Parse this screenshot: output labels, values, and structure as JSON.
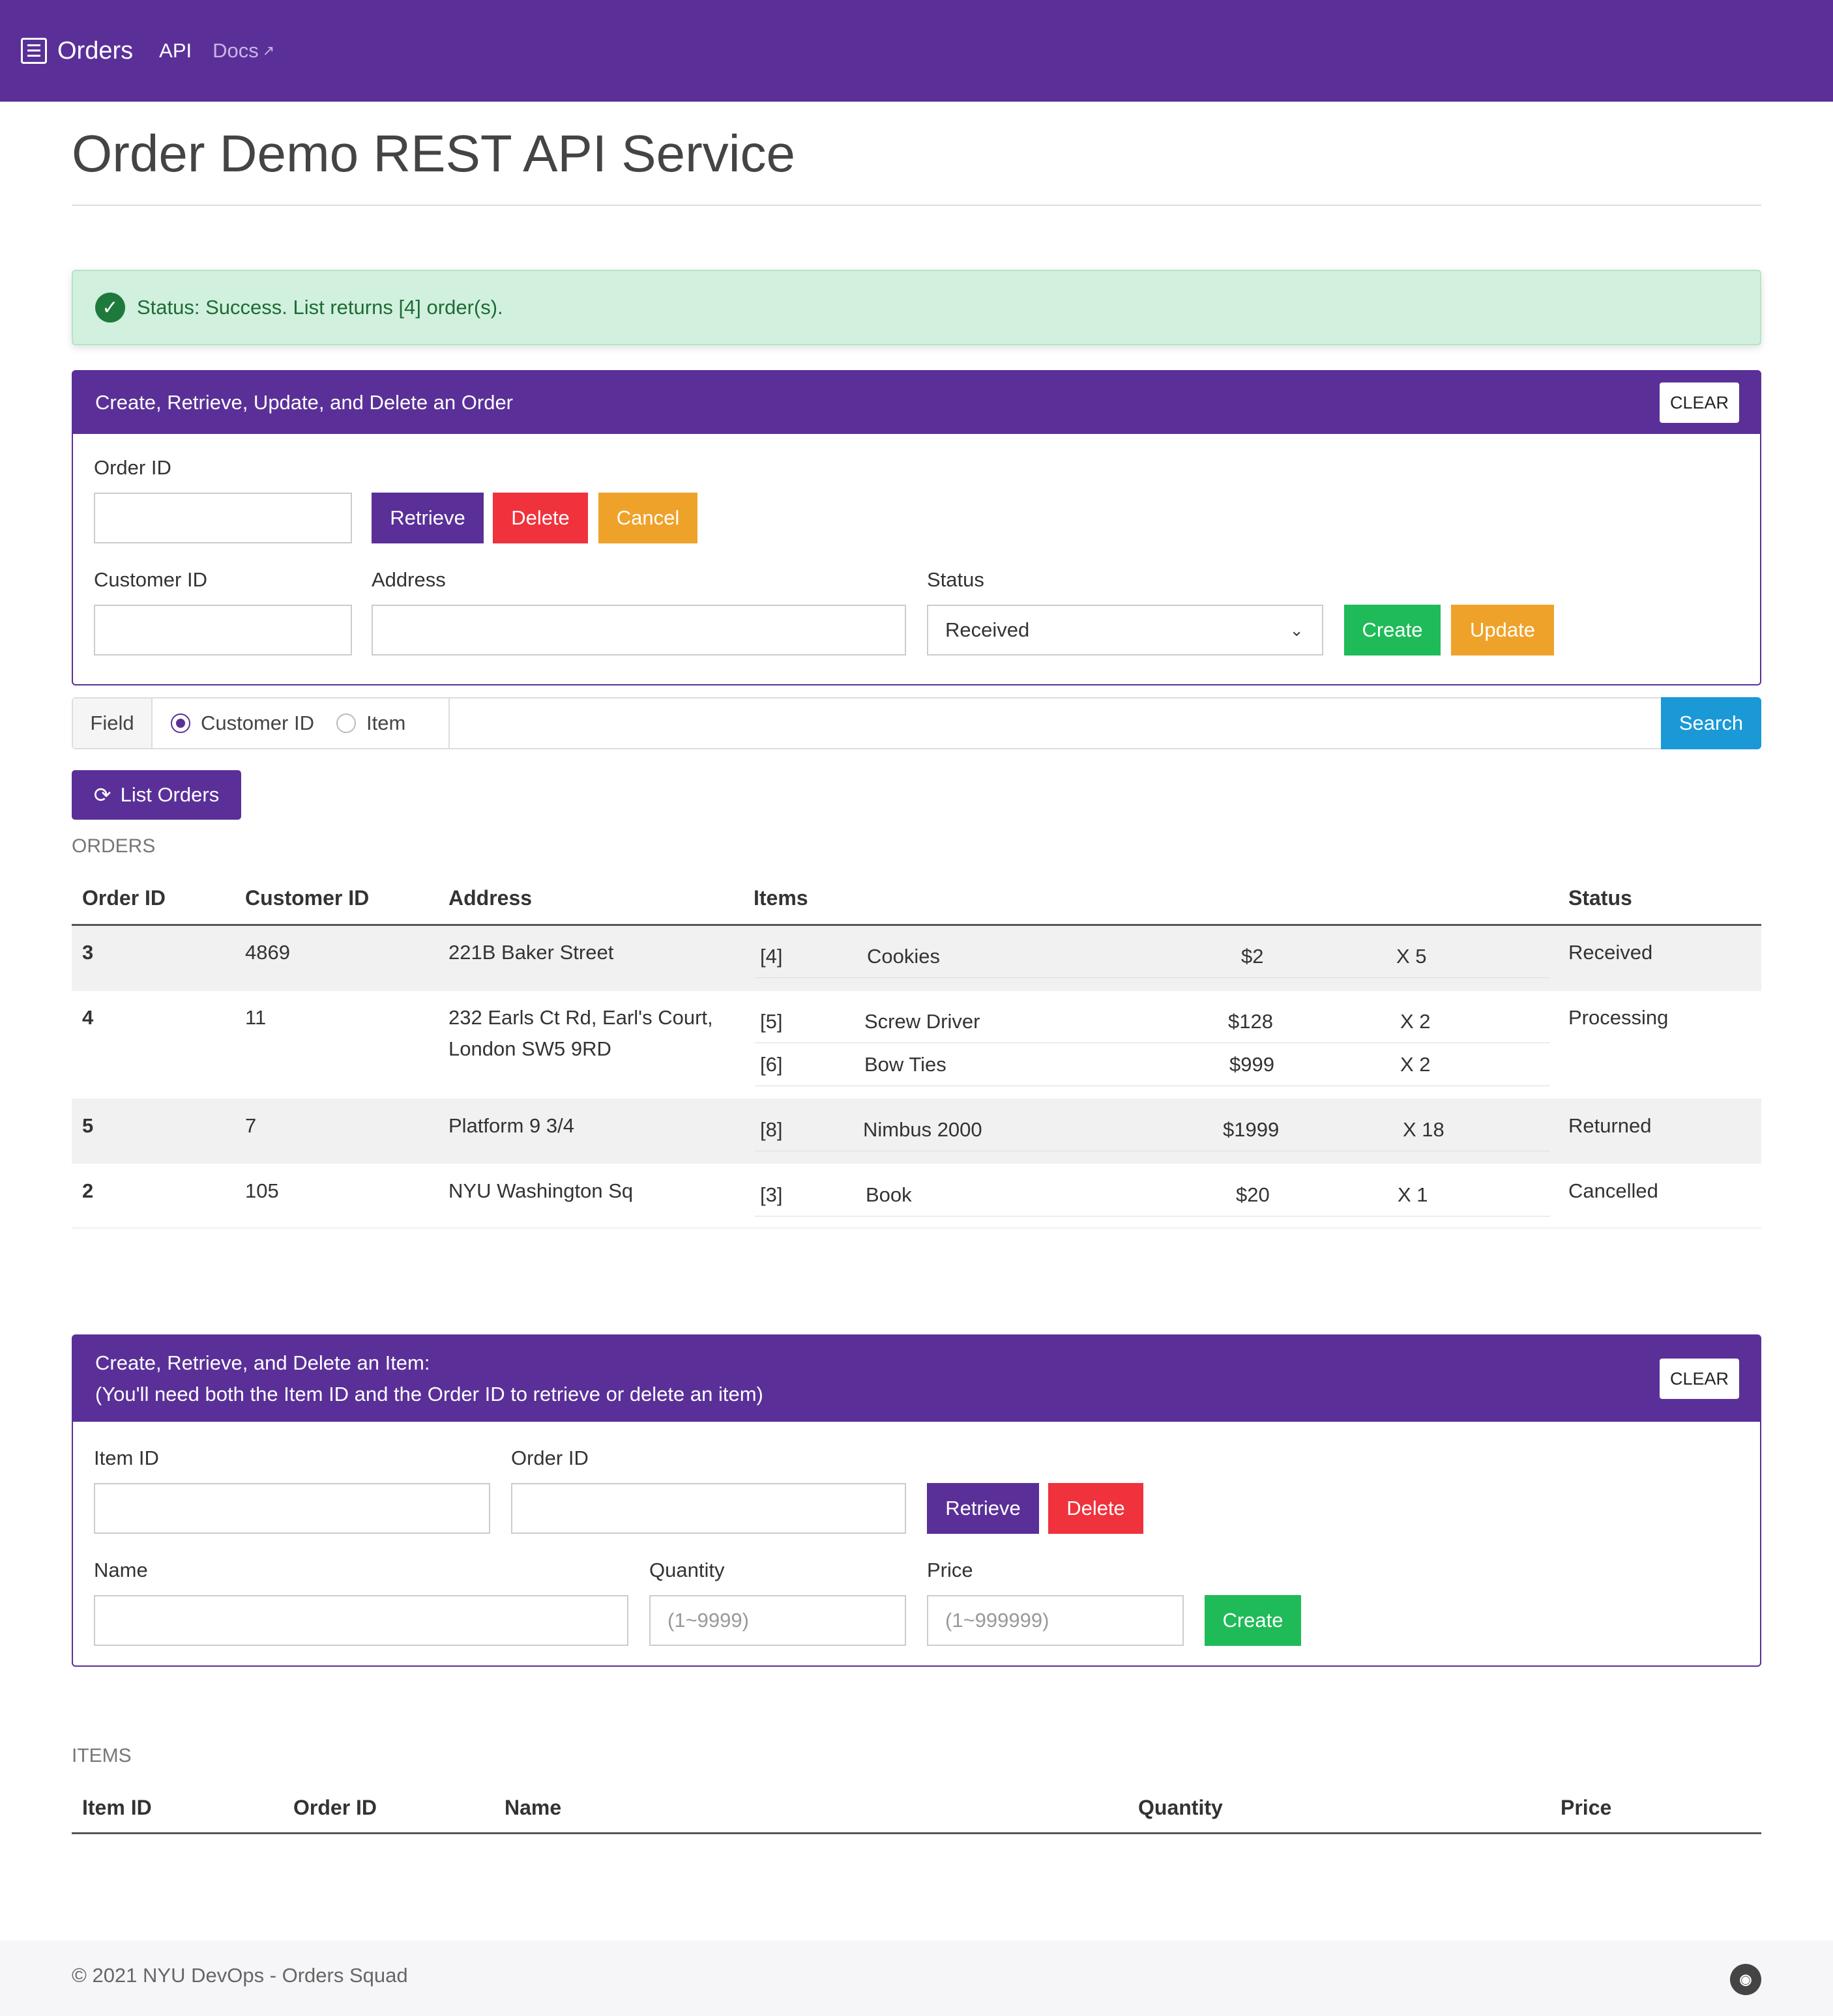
{
  "nav": {
    "brand": "Orders",
    "links": [
      {
        "label": "API"
      },
      {
        "label": "Docs"
      }
    ]
  },
  "page_title": "Order Demo REST API Service",
  "alert": {
    "text": "Status: Success. List returns [4] order(s)."
  },
  "order_form": {
    "title": "Create, Retrieve, Update, and Delete an Order",
    "clear": "CLEAR",
    "order_id_label": "Order ID",
    "order_id_value": "",
    "retrieve": "Retrieve",
    "delete": "Delete",
    "cancel": "Cancel",
    "customer_id_label": "Customer ID",
    "customer_id_value": "",
    "address_label": "Address",
    "address_value": "",
    "status_label": "Status",
    "status_value": "Received",
    "create": "Create",
    "update": "Update"
  },
  "search": {
    "field_label": "Field",
    "options": [
      "Customer ID",
      "Item"
    ],
    "selected": "Customer ID",
    "value": "",
    "button": "Search"
  },
  "list_orders": "List Orders",
  "orders": {
    "section_title": "ORDERS",
    "headers": [
      "Order ID",
      "Customer ID",
      "Address",
      "Items",
      "Status"
    ],
    "rows": [
      {
        "order_id": "3",
        "customer_id": "4869",
        "address": "221B Baker Street",
        "address2": "",
        "status": "Received",
        "items": [
          {
            "id": "[4]",
            "name": "Cookies",
            "price": "$2",
            "qty": "X 5"
          }
        ]
      },
      {
        "order_id": "4",
        "customer_id": "11",
        "address": "232 Earls Ct Rd, Earl's Court,",
        "address2": "London SW5 9RD",
        "status": "Processing",
        "items": [
          {
            "id": "[5]",
            "name": "Screw Driver",
            "price": "$128",
            "qty": "X 2"
          },
          {
            "id": "[6]",
            "name": "Bow Ties",
            "price": "$999",
            "qty": "X 2"
          }
        ]
      },
      {
        "order_id": "5",
        "customer_id": "7",
        "address": "Platform 9 3/4",
        "address2": "",
        "status": "Returned",
        "items": [
          {
            "id": "[8]",
            "name": "Nimbus 2000",
            "price": "$1999",
            "qty": "X 18"
          }
        ]
      },
      {
        "order_id": "2",
        "customer_id": "105",
        "address": "NYU Washington Sq",
        "address2": "",
        "status": "Cancelled",
        "items": [
          {
            "id": "[3]",
            "name": "Book",
            "price": "$20",
            "qty": "X 1"
          }
        ]
      }
    ]
  },
  "item_form": {
    "title_line1": "Create, Retrieve, and Delete an Item:",
    "title_line2": "(You'll need both the Item ID and the Order ID to retrieve or delete an item)",
    "clear": "CLEAR",
    "item_id_label": "Item ID",
    "order_id_label": "Order ID",
    "retrieve": "Retrieve",
    "delete": "Delete",
    "name_label": "Name",
    "quantity_label": "Quantity",
    "quantity_placeholder": "(1~9999)",
    "price_label": "Price",
    "price_placeholder": "(1~999999)",
    "create": "Create"
  },
  "items": {
    "section_title": "ITEMS",
    "headers": [
      "Item ID",
      "Order ID",
      "Name",
      "Quantity",
      "Price"
    ]
  },
  "footer": {
    "text": "© 2021 NYU DevOps - Orders Squad",
    "icon": "github-icon"
  },
  "colors": {
    "brand": "#5a3098",
    "danger": "#f0323c",
    "warning": "#efa22a",
    "success": "#1fbb58",
    "info": "#1a99d6",
    "alert_bg": "#d1f0dd"
  }
}
